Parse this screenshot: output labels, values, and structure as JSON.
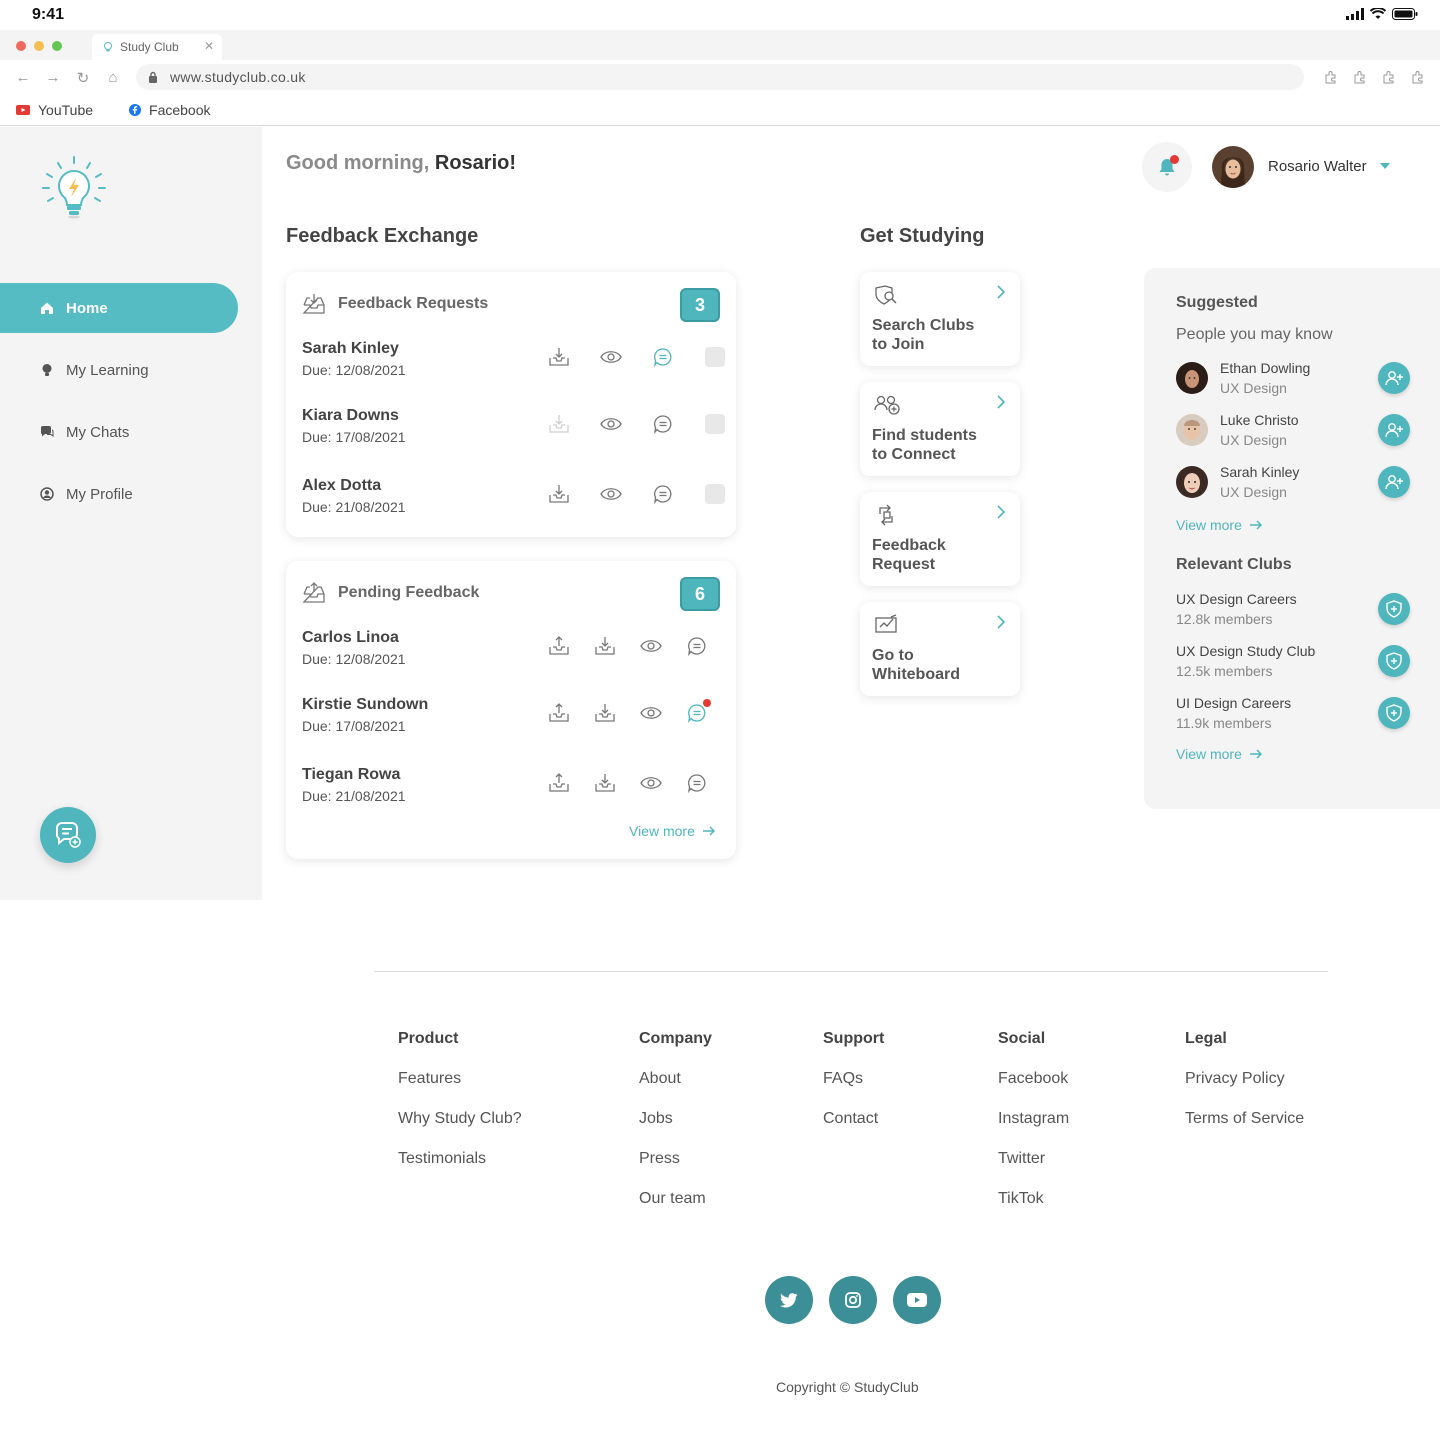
{
  "status_bar": {
    "time": "9:41"
  },
  "browser": {
    "tab_title": "Study Club",
    "url": "www.studyclub.co.uk",
    "bookmarks": [
      {
        "label": "YouTube"
      },
      {
        "label": "Facebook"
      }
    ]
  },
  "sidebar": {
    "items": [
      {
        "label": "Home",
        "icon": "home-icon"
      },
      {
        "label": "My Learning",
        "icon": "lightbulb-icon"
      },
      {
        "label": "My Chats",
        "icon": "chat-icon"
      },
      {
        "label": "My Profile",
        "icon": "user-circle-icon"
      }
    ]
  },
  "header": {
    "greeting": "Good morning,",
    "greeting_name": "Rosario!",
    "user_name": "Rosario Walter"
  },
  "feedback_exchange": {
    "title": "Feedback Exchange",
    "requests": {
      "title": "Feedback Requests",
      "count": "3",
      "rows": [
        {
          "name": "Sarah Kinley",
          "due": "Due: 12/08/2021"
        },
        {
          "name": "Kiara Downs",
          "due": "Due: 17/08/2021"
        },
        {
          "name": "Alex Dotta",
          "due": "Due: 21/08/2021"
        }
      ]
    },
    "pending": {
      "title": "Pending Feedback",
      "count": "6",
      "rows": [
        {
          "name": "Carlos Linoa",
          "due": "Due: 12/08/2021"
        },
        {
          "name": "Kirstie Sundown",
          "due": "Due: 17/08/2021"
        },
        {
          "name": "Tiegan Rowa",
          "due": "Due: 21/08/2021"
        }
      ],
      "view_more": "View more"
    }
  },
  "get_studying": {
    "title": "Get Studying",
    "tiles": [
      {
        "label": "Search Clubs to Join",
        "icon": "search-clubs-icon"
      },
      {
        "label": "Find students to Connect",
        "icon": "people-add-icon"
      },
      {
        "label": "Feedback Request",
        "icon": "exchange-icon"
      },
      {
        "label": "Go to Whiteboard",
        "icon": "whiteboard-icon"
      }
    ]
  },
  "suggested": {
    "title": "Suggested",
    "people_title": "People you may know",
    "people": [
      {
        "name": "Ethan Dowling",
        "role": "UX Design"
      },
      {
        "name": "Luke Christo",
        "role": "UX Design"
      },
      {
        "name": "Sarah Kinley",
        "role": "UX Design"
      }
    ],
    "people_view_more": "View more",
    "clubs_title": "Relevant Clubs",
    "clubs": [
      {
        "name": "UX Design Careers",
        "members": "12.8k members"
      },
      {
        "name": "UX Design Study Club",
        "members": "12.5k members"
      },
      {
        "name": "UI Design Careers",
        "members": "11.9k members"
      }
    ],
    "clubs_view_more": "View more"
  },
  "footer": {
    "columns": [
      {
        "heading": "Product",
        "links": [
          "Features",
          "Why Study Club?",
          "Testimonials"
        ]
      },
      {
        "heading": "Company",
        "links": [
          "About",
          "Jobs",
          "Press",
          "Our team"
        ]
      },
      {
        "heading": "Support",
        "links": [
          "FAQs",
          "Contact"
        ]
      },
      {
        "heading": "Social",
        "links": [
          "Facebook",
          "Instagram",
          "Twitter",
          "TikTok"
        ]
      },
      {
        "heading": "Legal",
        "links": [
          "Privacy Policy",
          "Terms of Service"
        ]
      }
    ],
    "socials": [
      "twitter-icon",
      "instagram-icon",
      "youtube-icon"
    ],
    "copyright": "Copyright © StudyClub"
  },
  "colors": {
    "accent": "#4fb6bd",
    "sidebar_bg": "#f4f4f4",
    "notification": "#e53935",
    "footer_social": "#3c8f97"
  }
}
